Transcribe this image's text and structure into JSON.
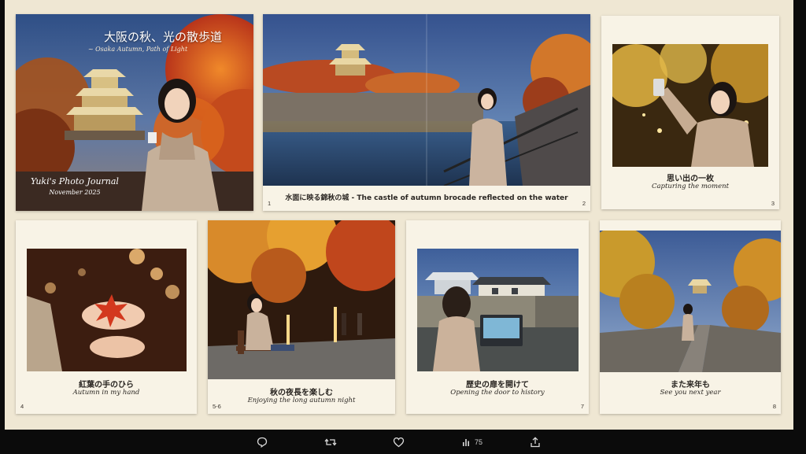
{
  "cover": {
    "title_jp": "大阪の秋、光の散歩道",
    "subtitle_en": "~ Osaka Autumn, Path of Light",
    "journal": "Yuki's Photo Journal",
    "date": "November 2025"
  },
  "pages": [
    {
      "num": "1",
      "num_right": "2",
      "caption": "水面に映る錦秋の城 - The castle of autumn brocade reflected on the water"
    },
    {
      "num": "3",
      "jp": "思い出の一枚",
      "en": "Capturing the moment"
    },
    {
      "num": "4",
      "jp": "紅葉の手のひら",
      "en": "Autumn in my hand"
    },
    {
      "num": "5-6",
      "jp": "秋の夜長を楽しむ",
      "en": "Enjoying the long autumn night"
    },
    {
      "num": "7",
      "jp": "歴史の扉を開けて",
      "en": "Opening the door to history"
    },
    {
      "num": "8",
      "jp": "また来年も",
      "en": "See you next year"
    }
  ],
  "toolbar": {
    "reply_icon": "reply-icon",
    "repost_icon": "repost-icon",
    "like_icon": "heart-icon",
    "views_icon": "views-chart-icon",
    "views_count": "75",
    "share_icon": "share-icon"
  }
}
